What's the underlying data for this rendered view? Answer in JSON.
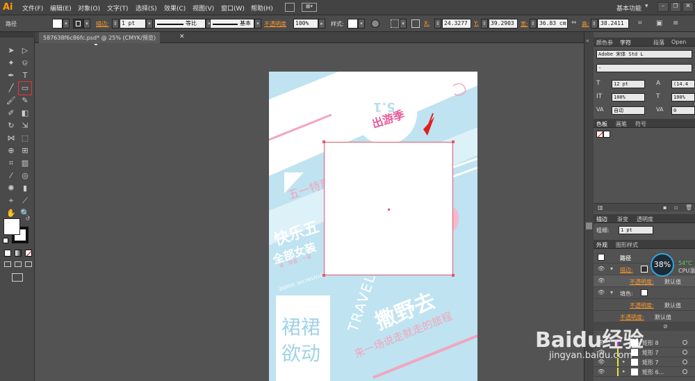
{
  "app": {
    "logo": "Ai"
  },
  "menus": [
    "文件(F)",
    "编辑(E)",
    "对象(O)",
    "文字(T)",
    "选择(S)",
    "效果(C)",
    "视图(V)",
    "窗口(W)",
    "帮助(H)"
  ],
  "workspace": "基本功能",
  "control_bar": {
    "path_label": "路径",
    "stroke_label": "描边:",
    "stroke_width": "1 pt",
    "stroke_profile": "等比",
    "brush_def": "基本",
    "opacity_label": "不透明度",
    "opacity_value": "100%",
    "style_label": "样式:",
    "x_value": "24.3277",
    "y_value": "39.2903",
    "w_label": "宽:",
    "w_value": "36.83 cm",
    "h_label": "高:",
    "h_value": "38.2411"
  },
  "document": {
    "tab_title": "587638f6c86fc.psd* @ 25% (CMYK/预览)"
  },
  "artwork": {
    "may_day": "5.1",
    "travel_season": "出游季",
    "wuyi_sale": "五一特惠",
    "happy": "快乐五",
    "all_women": "全部女装",
    "event_note": "活动时间: 2017年5月1日",
    "summer": "来 · 穿夏 · 一夏",
    "travel_en": "TRAVEL",
    "go_wild": "撒野去",
    "skirt": "裙裙",
    "move": "欲动",
    "journey": "来一场说走就走的旅程"
  },
  "panels": {
    "top_tabs": [
      "颜色参",
      "字符",
      "段落",
      "Open"
    ],
    "font_family": "Adobe 宋体 Std L",
    "font_style": "-",
    "font_size": "12 pt",
    "leading": "(14.4",
    "hscale": "100%",
    "vscale": "100%",
    "kerning": "自动",
    "tracking": "0",
    "swatch_tabs": [
      "色板",
      "画笔",
      "符号"
    ],
    "stroke_tabs": [
      "描边",
      "渐变",
      "透明度"
    ],
    "weight_label": "粗细:",
    "weight_value": "1 pt",
    "appearance_tabs": [
      "外观",
      "图形样式"
    ],
    "appearance_rows": {
      "path": "路径",
      "stroke": "描边:",
      "opacity_1": "不透明度:",
      "default_1": "默认值",
      "fill": "填色:",
      "opacity_2": "不透明度:",
      "default_2": "默认值",
      "opacity_3": "不透明度:",
      "default_3": "默认值"
    },
    "cpu_percent": "38%",
    "cpu_temp": "54°C",
    "cpu_label": "CPU温",
    "layers": [
      "矩形 8",
      "矩形 7",
      "矩形 7",
      "矩形 6..."
    ]
  },
  "watermark": {
    "brand": "Baidu经验",
    "url": "jingyan.baidu.com"
  }
}
